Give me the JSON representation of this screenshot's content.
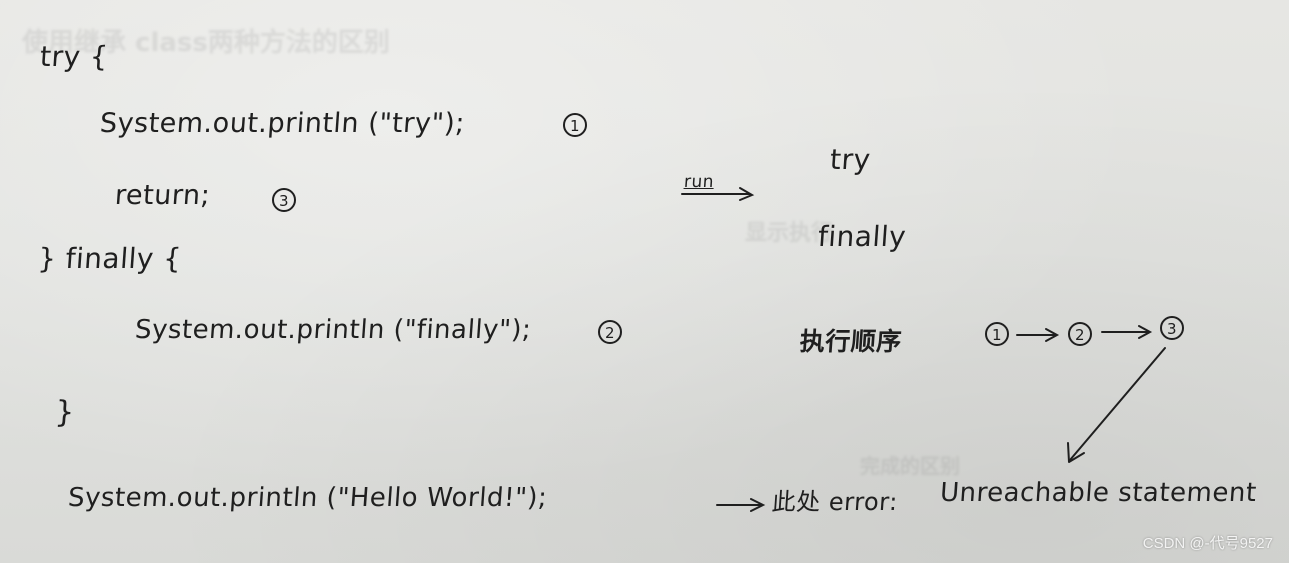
{
  "code": {
    "line_try_open": "try {",
    "line_print_try": "System.out.println (\"try\");",
    "marker_print_try": "1",
    "line_return": "return;",
    "marker_return": "3",
    "line_finally_open": "} finally {",
    "line_print_finally": "System.out.println (\"finally\");",
    "marker_print_finally": "2",
    "line_close": "}",
    "line_print_hello": "System.out.println (\"Hello World!\");"
  },
  "output": {
    "run_label": "run",
    "lines": [
      "try",
      "finally"
    ]
  },
  "execution_order": {
    "label": "执行顺序",
    "steps": [
      "1",
      "2",
      "3"
    ]
  },
  "error_note": {
    "label": "此处 error:",
    "message": "Unreachable statement"
  },
  "ghost_text": {
    "top": "使用继承 class两种方法的区别",
    "mid": "显示执行",
    "bottom": "完成的区别"
  },
  "watermark": "CSDN @-代号9527"
}
